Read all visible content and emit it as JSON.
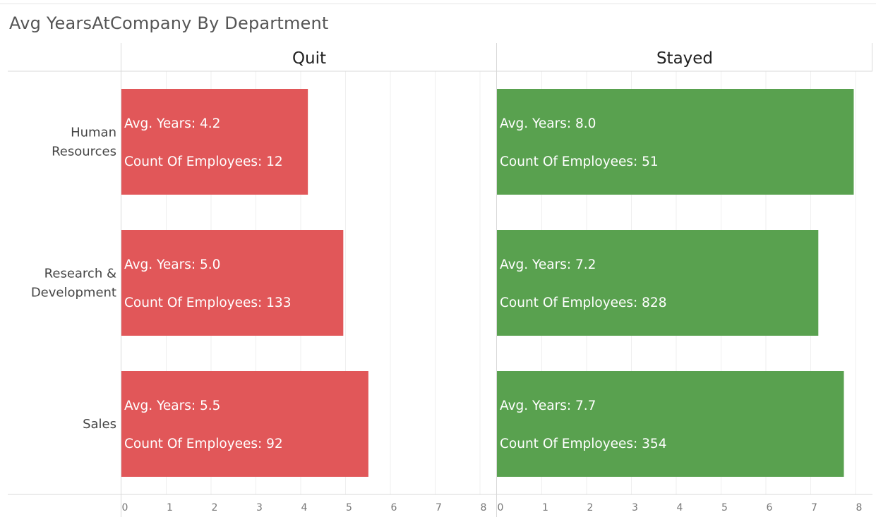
{
  "title": "Avg YearsAtCompany By Department",
  "colors": {
    "quit": "#e15759",
    "stayed": "#59a14f",
    "grid": "#efefef",
    "axis": "#d9d9d9"
  },
  "chart_data": {
    "type": "bar",
    "orientation": "horizontal",
    "title": "Avg YearsAtCompany By Department",
    "xlim": [
      0,
      8
    ],
    "x_ticks": [
      "0",
      "1",
      "2",
      "3",
      "4",
      "5",
      "6",
      "7",
      "8"
    ],
    "grid": true,
    "categories": [
      {
        "id": "hr",
        "lines": [
          "Human",
          "Resources"
        ]
      },
      {
        "id": "rd",
        "lines": [
          "Research &",
          "Development"
        ]
      },
      {
        "id": "sales",
        "lines": [
          "Sales"
        ]
      }
    ],
    "panels": [
      {
        "name": "Quit",
        "color": "#e15759",
        "bars": [
          {
            "value": 4.16,
            "avg_label": "Avg. Years: 4.2",
            "count_label": "Count Of Employees: 12"
          },
          {
            "value": 4.95,
            "avg_label": "Avg. Years: 5.0",
            "count_label": "Count Of Employees: 133"
          },
          {
            "value": 5.51,
            "avg_label": "Avg. Years: 5.5",
            "count_label": "Count Of Employees: 92"
          }
        ]
      },
      {
        "name": "Stayed",
        "color": "#59a14f",
        "bars": [
          {
            "value": 7.96,
            "avg_label": "Avg. Years: 8.0",
            "count_label": "Count Of Employees: 51"
          },
          {
            "value": 7.17,
            "avg_label": "Avg. Years: 7.2",
            "count_label": "Count Of Employees: 828"
          },
          {
            "value": 7.74,
            "avg_label": "Avg. Years: 7.7",
            "count_label": "Count Of Employees: 354"
          }
        ]
      }
    ]
  }
}
